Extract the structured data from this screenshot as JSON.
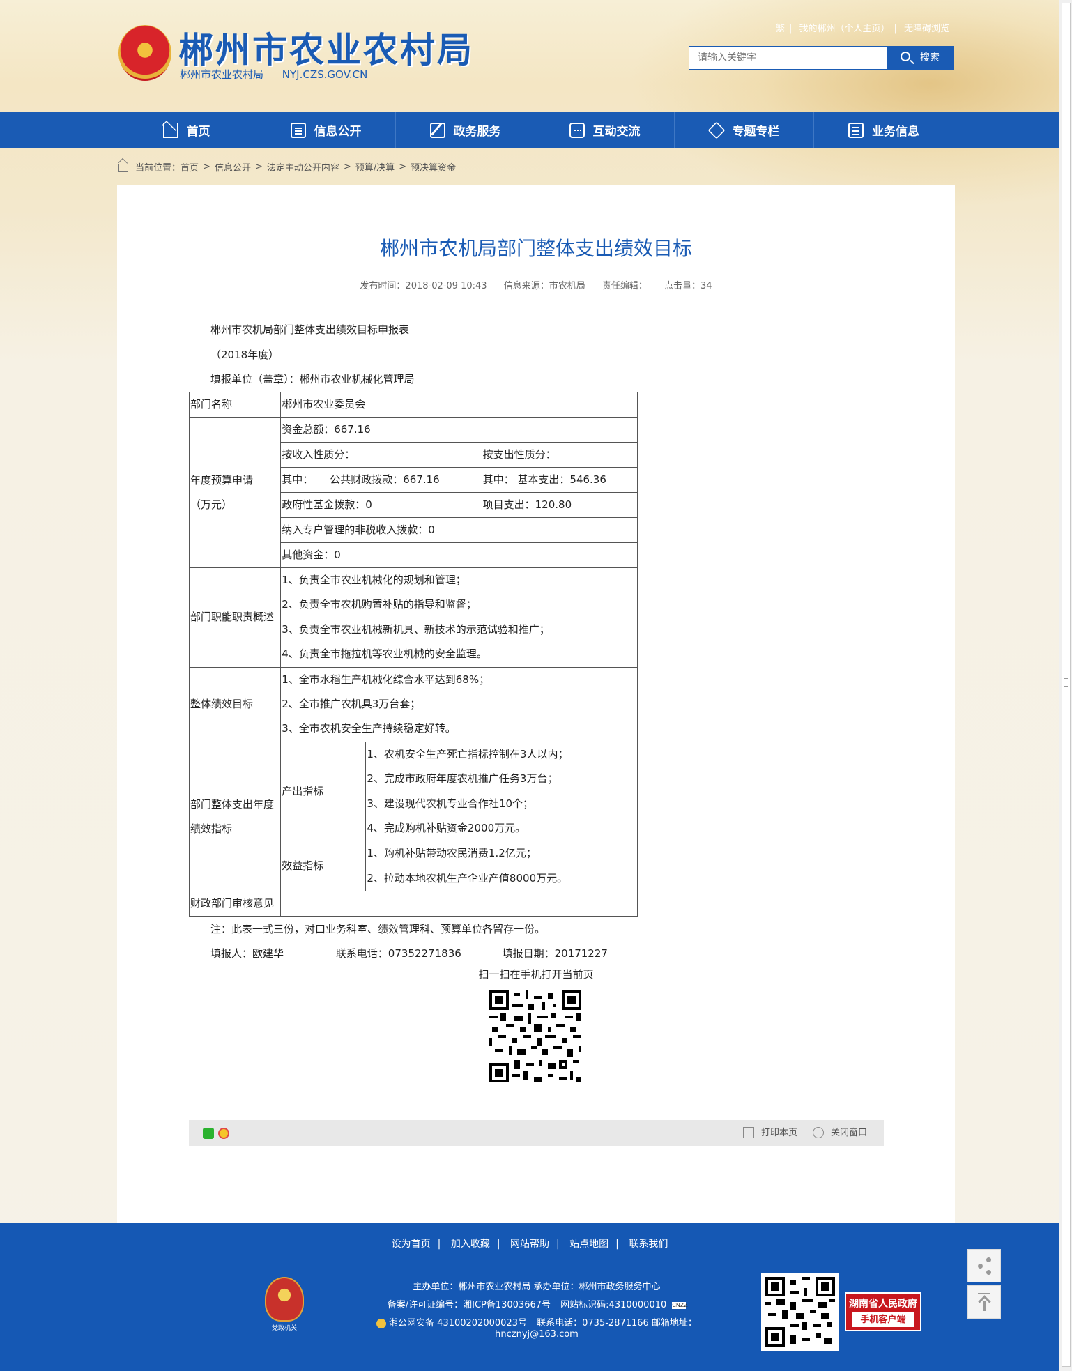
{
  "header": {
    "site_title": "郴州市农业农村局",
    "site_sub_name": "郴州市农业农村局",
    "site_domain": "NYJ.CZS.GOV.CN",
    "top_links": [
      "繁",
      "我的郴州（个人主页）",
      "无障碍浏览"
    ],
    "search_placeholder": "请输入关键字",
    "search_button": "搜索"
  },
  "nav": {
    "items": [
      "首页",
      "信息公开",
      "政务服务",
      "互动交流",
      "专题专栏",
      "业务信息"
    ]
  },
  "breadcrumb": {
    "label": "当前位置：",
    "items": [
      "首页",
      "信息公开",
      "法定主动公开内容",
      "预算/决算",
      "预决算资金"
    ],
    "sep": ">"
  },
  "article": {
    "title": "郴州市农机局部门整体支出绩效目标",
    "publish_time": "发布时间：2018-02-09 10:43",
    "source": "信息来源：市农机局",
    "editor": "责任编辑：",
    "hits": "点击量：34",
    "intro": [
      "郴州市农机局部门整体支出绩效目标申报表",
      "（2018年度）",
      "填报单位（盖章）：郴州市农业机械化管理局"
    ],
    "table": {
      "dept_name_label": "部门名称",
      "dept_name_value": "郴州市农业委员会",
      "budget_label_1": "年度预算申请",
      "budget_label_2": "（万元）",
      "total_funds": "资金总额：667.16",
      "by_income": "按收入性质分：",
      "by_expense": "按支出性质分：",
      "income_detail_prefix": "其中：",
      "income_detail_value": "公共财政拨款：667.16",
      "expense_detail": "其中： 基本支出：546.36",
      "gov_fund": "政府性基金拨款：0",
      "project_expense": "项目支出：120.80",
      "nontax": "纳入专户管理的非税收入拨款：0",
      "other_funds": "其他资金：0",
      "duties_label": "部门职能职责概述",
      "duties": [
        "1、负责全市农业机械化的规划和管理；",
        "2、负责全市农机购置补贴的指导和监督；",
        "3、负责全市农业机械新机具、新技术的示范试验和推广；",
        "4、负责全市拖拉机等农业机械的安全监理。"
      ],
      "goals_label": "整体绩效目标",
      "goals": [
        "1、全市水稻生产机械化综合水平达到68%；",
        "2、全市推广农机具3万台套；",
        "3、全市农机安全生产持续稳定好转。"
      ],
      "indicator_label_1": "部门整体支出年度",
      "indicator_label_2": "绩效指标",
      "output_label": "产出指标",
      "output_items": [
        "1、农机安全生产死亡指标控制在3人以内；",
        "2、完成市政府年度农机推广任务3万台；",
        "3、建设现代农机专业合作社10个；",
        "4、完成购机补贴资金2000万元。"
      ],
      "benefit_label": "效益指标",
      "benefit_items": [
        "1、购机补贴带动农民消费1.2亿元；",
        "2、拉动本地农机生产企业产值8000万元。"
      ],
      "finance_label": "财政部门审核意见",
      "finance_value": ""
    },
    "note": "注：此表一式三份，对口业务科室、绩效管理科、预算单位各留存一份。",
    "filler": "填报人：欧建华",
    "phone": "联系电话：07352271836",
    "date": "填报日期：20171227",
    "qr_label": "扫一扫在手机打开当前页"
  },
  "share_bar": {
    "print": "打印本页",
    "close": "关闭窗口"
  },
  "footer": {
    "links": [
      "设为首页",
      "加入收藏",
      "网站帮助",
      "站点地图",
      "联系我们"
    ],
    "badge_label": "党政机关",
    "host": "主办单位：郴州市农业农村局   承办单位：郴州市政务服务中心",
    "icp_prefix": "备案/许可证编号：",
    "icp": "湘ICP备13003667号",
    "site_id": "网站标识码:4310000010",
    "cnzz": "CNZZ",
    "police": "湘公网安备 43100202000023号",
    "contact": "联系电话：0735-2871166   邮箱地址：",
    "email": "hncznyj@163.com",
    "app_title": "湖南省人民政府",
    "app_button": "手机客户端"
  },
  "colors": {
    "brand_blue": "#1a5bb4",
    "footer_blue": "#1558b4",
    "app_red": "#c8171e"
  }
}
